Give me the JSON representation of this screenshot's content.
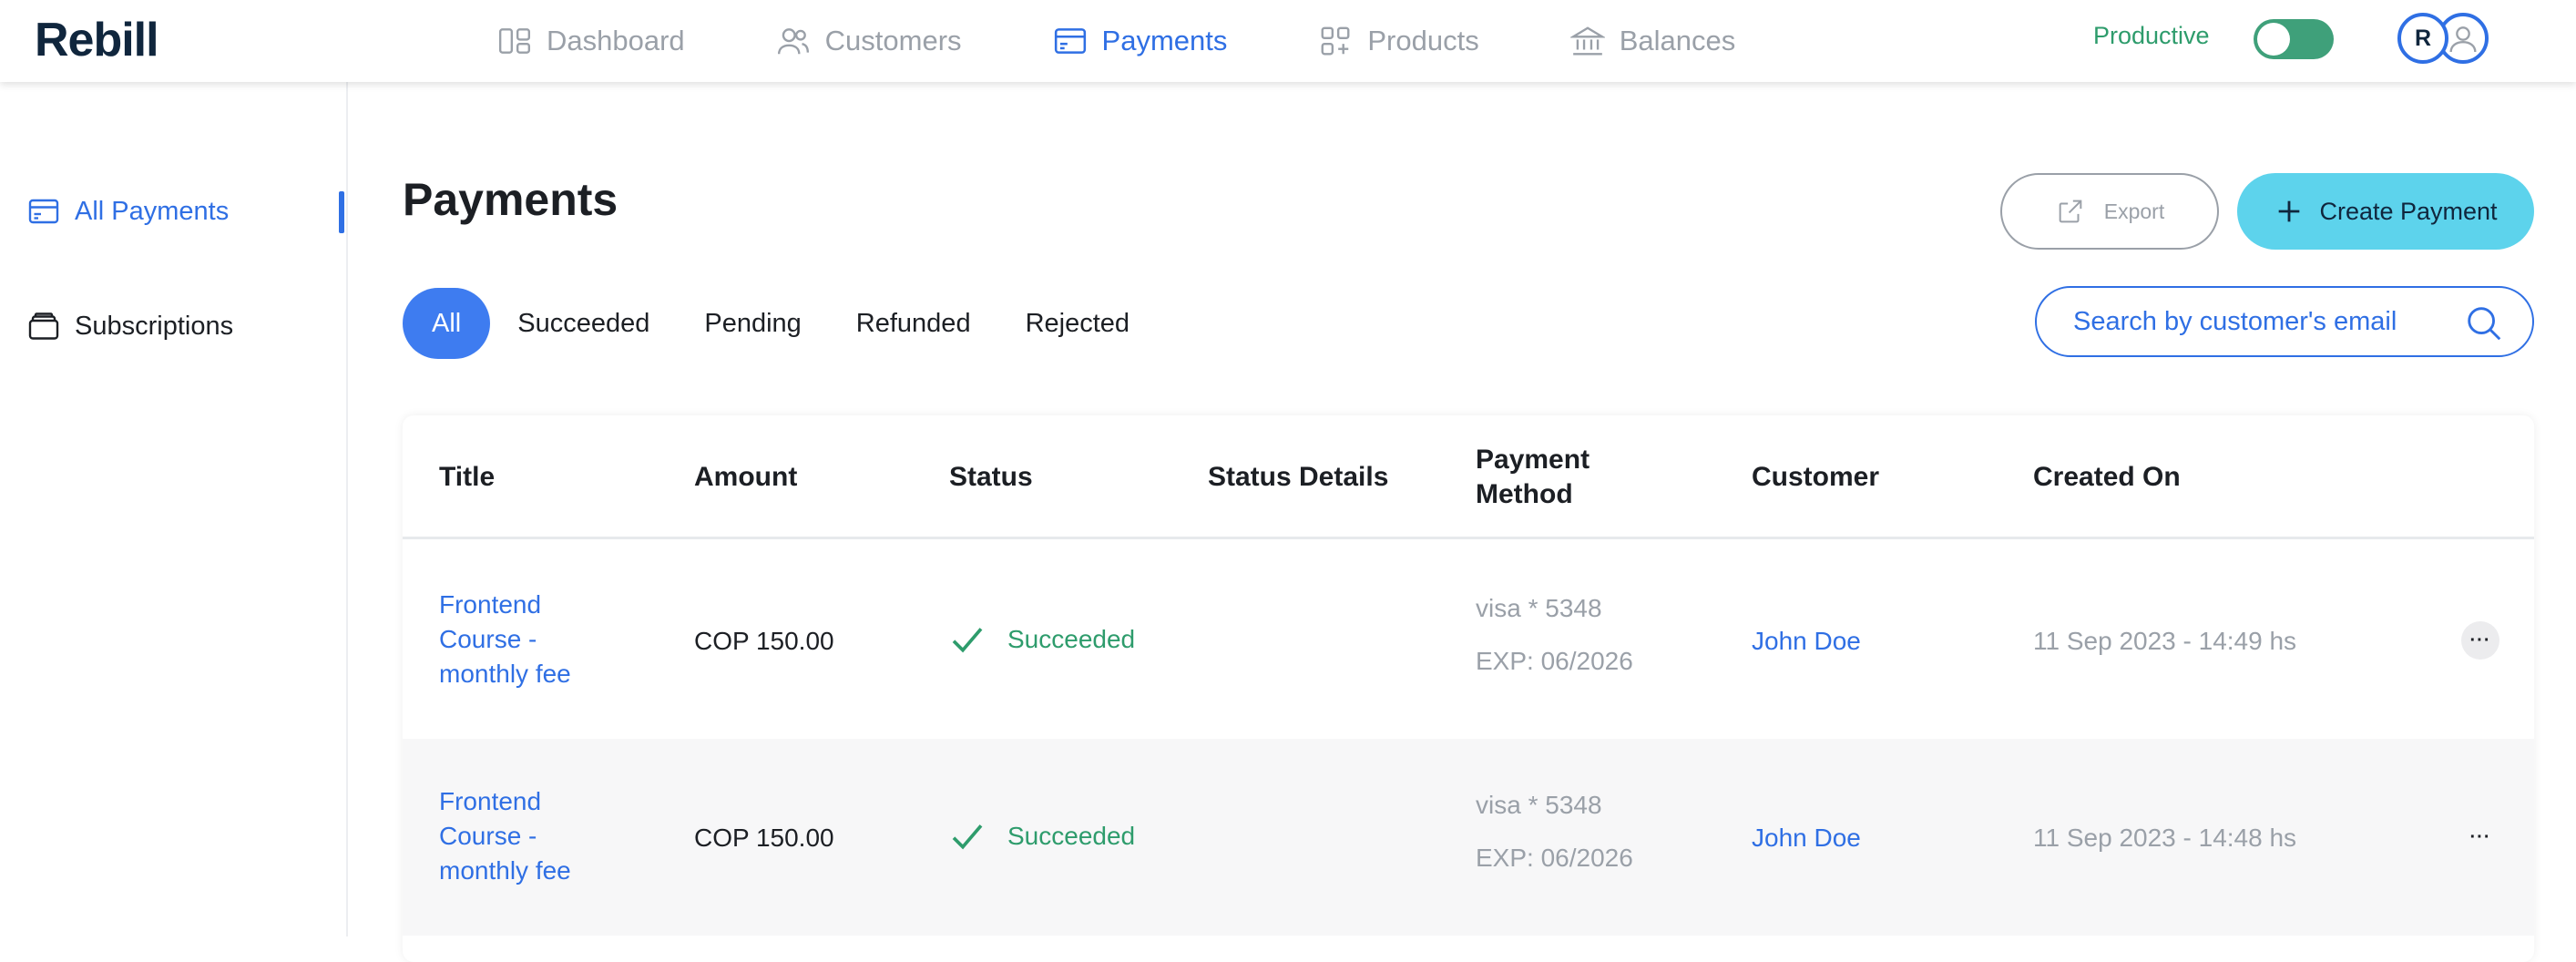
{
  "app": {
    "logo": "Rebill",
    "environment_label": "Productive",
    "avatar_initial": "R"
  },
  "nav": {
    "items": [
      {
        "label": "Dashboard",
        "icon": "dashboard-icon"
      },
      {
        "label": "Customers",
        "icon": "users-icon"
      },
      {
        "label": "Payments",
        "icon": "credit-card-icon",
        "active": true
      },
      {
        "label": "Products",
        "icon": "products-icon"
      },
      {
        "label": "Balances",
        "icon": "bank-icon"
      }
    ]
  },
  "sidebar": {
    "items": [
      {
        "label": "All Payments",
        "icon": "credit-card-icon",
        "active": true
      },
      {
        "label": "Subscriptions",
        "icon": "subscriptions-icon"
      }
    ]
  },
  "main": {
    "title": "Payments",
    "export_label": "Export",
    "create_label": "Create Payment",
    "search_placeholder": "Search by customer's email",
    "filters": [
      "All",
      "Succeeded",
      "Pending",
      "Refunded",
      "Rejected"
    ],
    "active_filter": "All"
  },
  "table": {
    "columns": [
      "Title",
      "Amount",
      "Status",
      "Status Details",
      "Payment Method",
      "Customer",
      "Created On"
    ],
    "rows": [
      {
        "title": "Frontend Course - monthly fee",
        "amount": "COP 150.00",
        "status": "Succeeded",
        "status_details": "",
        "method_line1": "visa * 5348",
        "method_line2": "EXP: 06/2026",
        "customer": "John Doe",
        "created_on": "11 Sep 2023 - 14:49 hs"
      },
      {
        "title": "Frontend Course - monthly fee",
        "amount": "COP 150.00",
        "status": "Succeeded",
        "status_details": "",
        "method_line1": "visa * 5348",
        "method_line2": "EXP: 06/2026",
        "customer": "John Doe",
        "created_on": "11 Sep 2023 - 14:48 hs"
      }
    ]
  },
  "colors": {
    "accent": "#2f6fe4",
    "success": "#2e9c6c",
    "create_button": "#5dd3ec",
    "logo": "#10263d"
  }
}
